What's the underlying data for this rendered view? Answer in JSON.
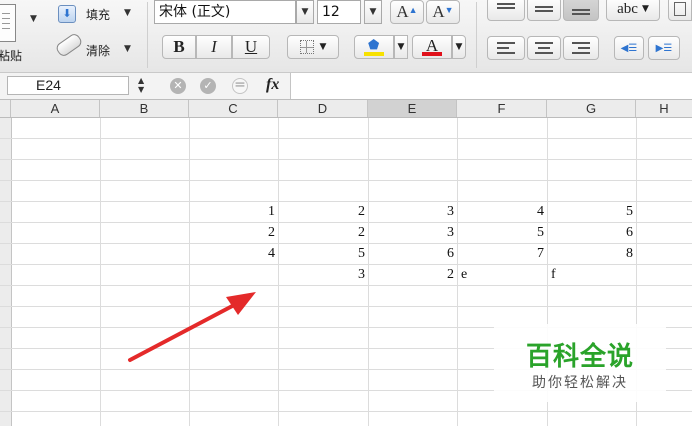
{
  "ribbon": {
    "fill_label": "填充",
    "clear_label": "清除",
    "paste_label": "粘贴",
    "font_name": "宋体 (正文)",
    "font_size": "12",
    "grow_font": "A",
    "shrink_font": "A",
    "bold": "B",
    "italic": "I",
    "underline": "U",
    "font_color_letter": "A",
    "wrap_label": "abc",
    "highlight_color": "#f7e100",
    "font_color": "#e0101a",
    "accent_icon_color": "#2e74d0"
  },
  "formula_bar": {
    "name_box": "E24",
    "fx_label": "fx",
    "formula_value": ""
  },
  "sheet": {
    "columns": [
      "A",
      "B",
      "C",
      "D",
      "E",
      "F",
      "G",
      "H"
    ],
    "active_column": "E",
    "rows": [
      {
        "c": "1",
        "d": "2",
        "e": "3",
        "f": "4",
        "g": "5"
      },
      {
        "c": "2",
        "d": "2",
        "e": "3",
        "f": "5",
        "g": "6"
      },
      {
        "c": "4",
        "d": "5",
        "e": "6",
        "f": "7",
        "g": "8"
      },
      {
        "c": "",
        "d": "3",
        "e": "2",
        "f": "e",
        "g": "f"
      }
    ]
  },
  "annotation": {
    "arrow_color": "#e42a2a"
  },
  "watermark": {
    "title": "百科全说",
    "subtitle": "助你轻松解决",
    "title_color": "#2aa32a"
  }
}
